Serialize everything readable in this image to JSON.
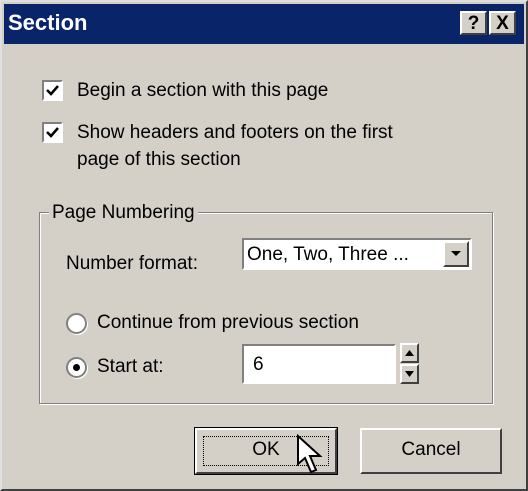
{
  "window": {
    "title": "Section",
    "help_button": "?",
    "close_button": "X"
  },
  "options": {
    "begin_section": {
      "label": "Begin a section with this page",
      "checked": true
    },
    "show_headers_line1": "Show headers and footers on the first",
    "show_headers_line2": "page of this section",
    "show_headers_checked": true
  },
  "page_numbering": {
    "group_label": "Page Numbering",
    "number_format_label": "Number format:",
    "number_format_value": "One, Two, Three ...",
    "continue_label": "Continue from previous section",
    "continue_selected": false,
    "start_at_label": "Start at:",
    "start_at_selected": true,
    "start_at_value": "6"
  },
  "buttons": {
    "ok_label": "OK",
    "cancel_label": "Cancel"
  },
  "colors": {
    "titlebar": "#0a246a",
    "face": "#d4d0c8"
  }
}
